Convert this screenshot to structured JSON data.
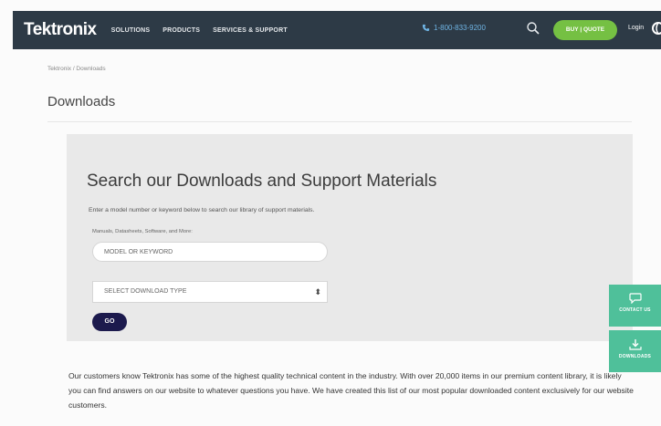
{
  "header": {
    "logo": "Tektronix",
    "nav": [
      "SOLUTIONS",
      "PRODUCTS",
      "SERVICES & SUPPORT"
    ],
    "phone": "1-800-833-9200",
    "buy_label": "BUY | QUOTE",
    "login_label": "Login"
  },
  "breadcrumb": "Tektronix / Downloads",
  "page_title": "Downloads",
  "search_panel": {
    "title": "Search our Downloads and Support Materials",
    "description": "Enter a model number or keyword below to search our library of support materials.",
    "field_label": "Manuals, Datasheets, Software, and More:",
    "input_placeholder": "MODEL OR KEYWORD",
    "select_value": "SELECT DOWNLOAD TYPE",
    "go_label": "GO"
  },
  "body_text": "Our customers know Tektronix has some of the highest quality technical content in the industry. With over 20,000 items in our premium content library, it is likely you can find answers on our website to whatever questions you have. We have created this list of our most popular downloaded content exclusively for our website customers.",
  "side_tabs": {
    "contact_label": "CONTACT US",
    "downloads_label": "DOWNLOADS"
  },
  "colors": {
    "header_bg": "#2d3a46",
    "buy_green": "#75c043",
    "go_navy": "#1c1a4d",
    "side_tab_green": "#4fc09a",
    "phone_blue": "#6fb4e4"
  },
  "icons": [
    "phone-icon",
    "search-icon",
    "globe-icon",
    "chat-icon",
    "download-icon"
  ]
}
